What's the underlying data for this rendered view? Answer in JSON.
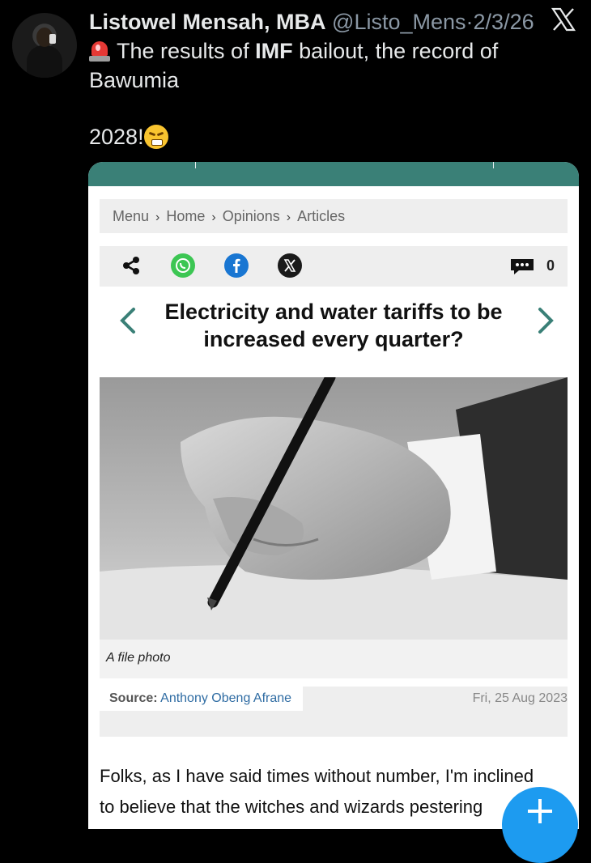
{
  "tweet": {
    "author_name": "Listowel Mensah, MBA",
    "handle": "@Listo_Mens",
    "separator": "·",
    "date": "2/3/26",
    "line1_pre": "The results of ",
    "line1_bold": "IMF",
    "line1_post": " bailout, the record of",
    "line2": "Bawumia",
    "line3": "2028!"
  },
  "article": {
    "breadcrumb": [
      "Menu",
      "Home",
      "Opinions",
      "Articles"
    ],
    "breadcrumb_sep": "›",
    "comment_count": "0",
    "headline_line1": "Electricity and water tariffs to be",
    "headline_line2": "increased every quarter?",
    "caption": "A file photo",
    "source_label": "Source:",
    "source_name": "Anthony Obeng Afrane",
    "source_date": "Fri, 25 Aug 2023",
    "body_line1": "Folks, as I have said times without number, I'm inclined",
    "body_line2": "to believe that the witches and wizards pestering"
  },
  "colors": {
    "accent_teal": "#3a8077",
    "chevron_teal": "#3a8077",
    "fab_blue": "#1d9bf0",
    "source_link": "#2f6ca3"
  },
  "icons": [
    "x-logo-icon",
    "siren-icon",
    "face-with-steam-icon",
    "share-icon",
    "whatsapp-icon",
    "facebook-icon",
    "x-share-icon",
    "comment-icon",
    "chevron-left-icon",
    "chevron-right-icon",
    "plus-icon"
  ]
}
